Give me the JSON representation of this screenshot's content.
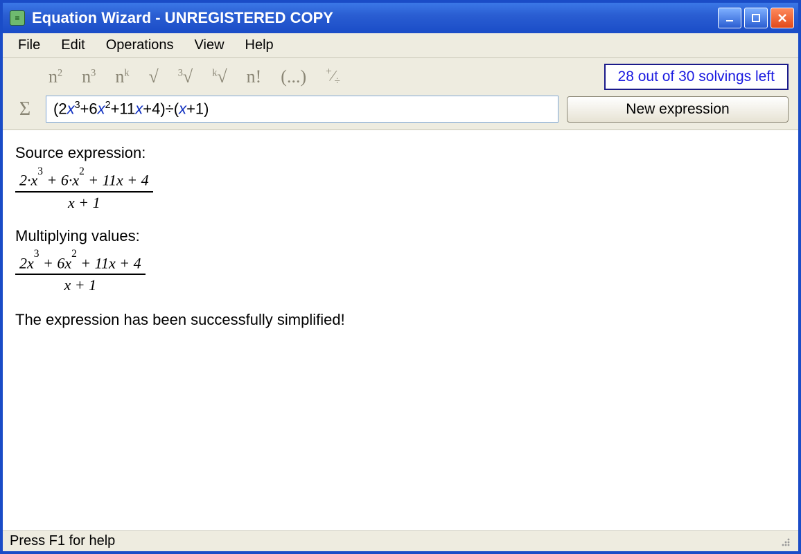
{
  "window": {
    "title": "Equation Wizard - UNREGISTERED COPY"
  },
  "menubar": {
    "items": [
      "File",
      "Edit",
      "Operations",
      "View",
      "Help"
    ]
  },
  "toolbar": {
    "math_buttons": [
      "n²",
      "n³",
      "nᵏ",
      "√",
      "³√",
      "ᵏ√",
      "n!",
      "(...)",
      "⁺∕₋"
    ],
    "solvings_left": "28 out of 30 solvings left",
    "sigma": "Σ",
    "expression_html": "(2<span class='xvar'>x</span><sup>3</sup>+6<span class='xvar'>x</span><sup>2</sup>+11<span class='xvar'>x</span>+4)÷(<span class='xvar'>x</span>+1)",
    "expression_plain": "(2x³+6x²+11x+4)÷(x+1)",
    "new_expression_label": "New expression"
  },
  "content": {
    "step1_label": "Source expression:",
    "step1_num": "2·<i>x</i><sup>3</sup> + 6·<i>x</i><sup>2</sup> + 11<i>x</i> + 4",
    "step1_den": "<i>x</i> + 1",
    "step2_label": "Multiplying values:",
    "step2_num": "2<i>x</i><sup>3</sup> + 6<i>x</i><sup>2</sup> + 11<i>x</i> + 4",
    "step2_den": "<i>x</i> + 1",
    "success_msg": "The expression has been successfully simplified!"
  },
  "statusbar": {
    "text": "Press F1 for help"
  }
}
